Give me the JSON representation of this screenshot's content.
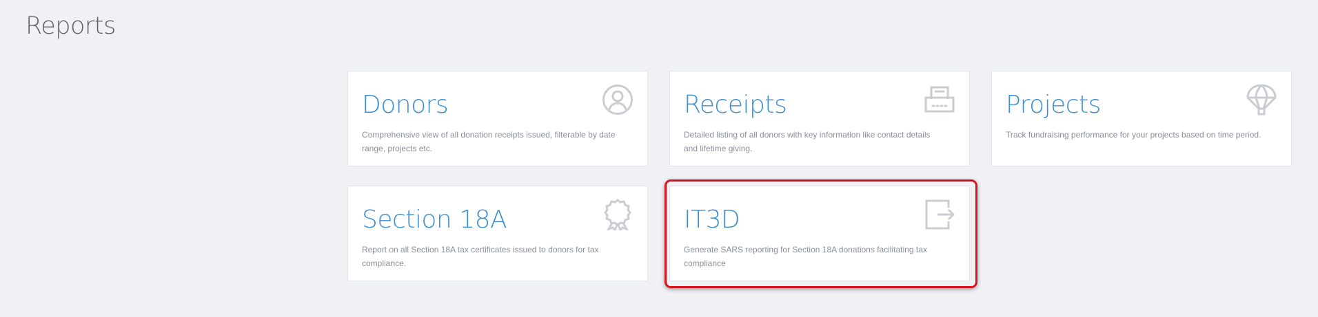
{
  "page": {
    "title": "Reports"
  },
  "colors": {
    "background": "#f0f1f5",
    "card_title": "#3a8fd0",
    "card_desc": "#8a8f96",
    "icon": "#c9ccd1",
    "highlight": "#d4151c"
  },
  "cards": [
    {
      "title": "Donors",
      "description": "Comprehensive view of all donation receipts issued, filterable by date range, projects etc.",
      "icon": "user-circle-icon"
    },
    {
      "title": "Receipts",
      "description": "Detailed listing of all donors with key information like contact details and lifetime giving.",
      "icon": "printer-receipt-icon"
    },
    {
      "title": "Projects",
      "description": "Track fundraising performance for your projects based on time period.",
      "icon": "parachute-icon"
    },
    {
      "title": "Section 18A",
      "description": "Report on all Section 18A tax certificates issued to donors for tax compliance.",
      "icon": "award-badge-icon"
    },
    {
      "title": "IT3D",
      "description": "Generate SARS reporting for Section 18A donations facilitating tax compliance",
      "icon": "export-icon"
    }
  ]
}
